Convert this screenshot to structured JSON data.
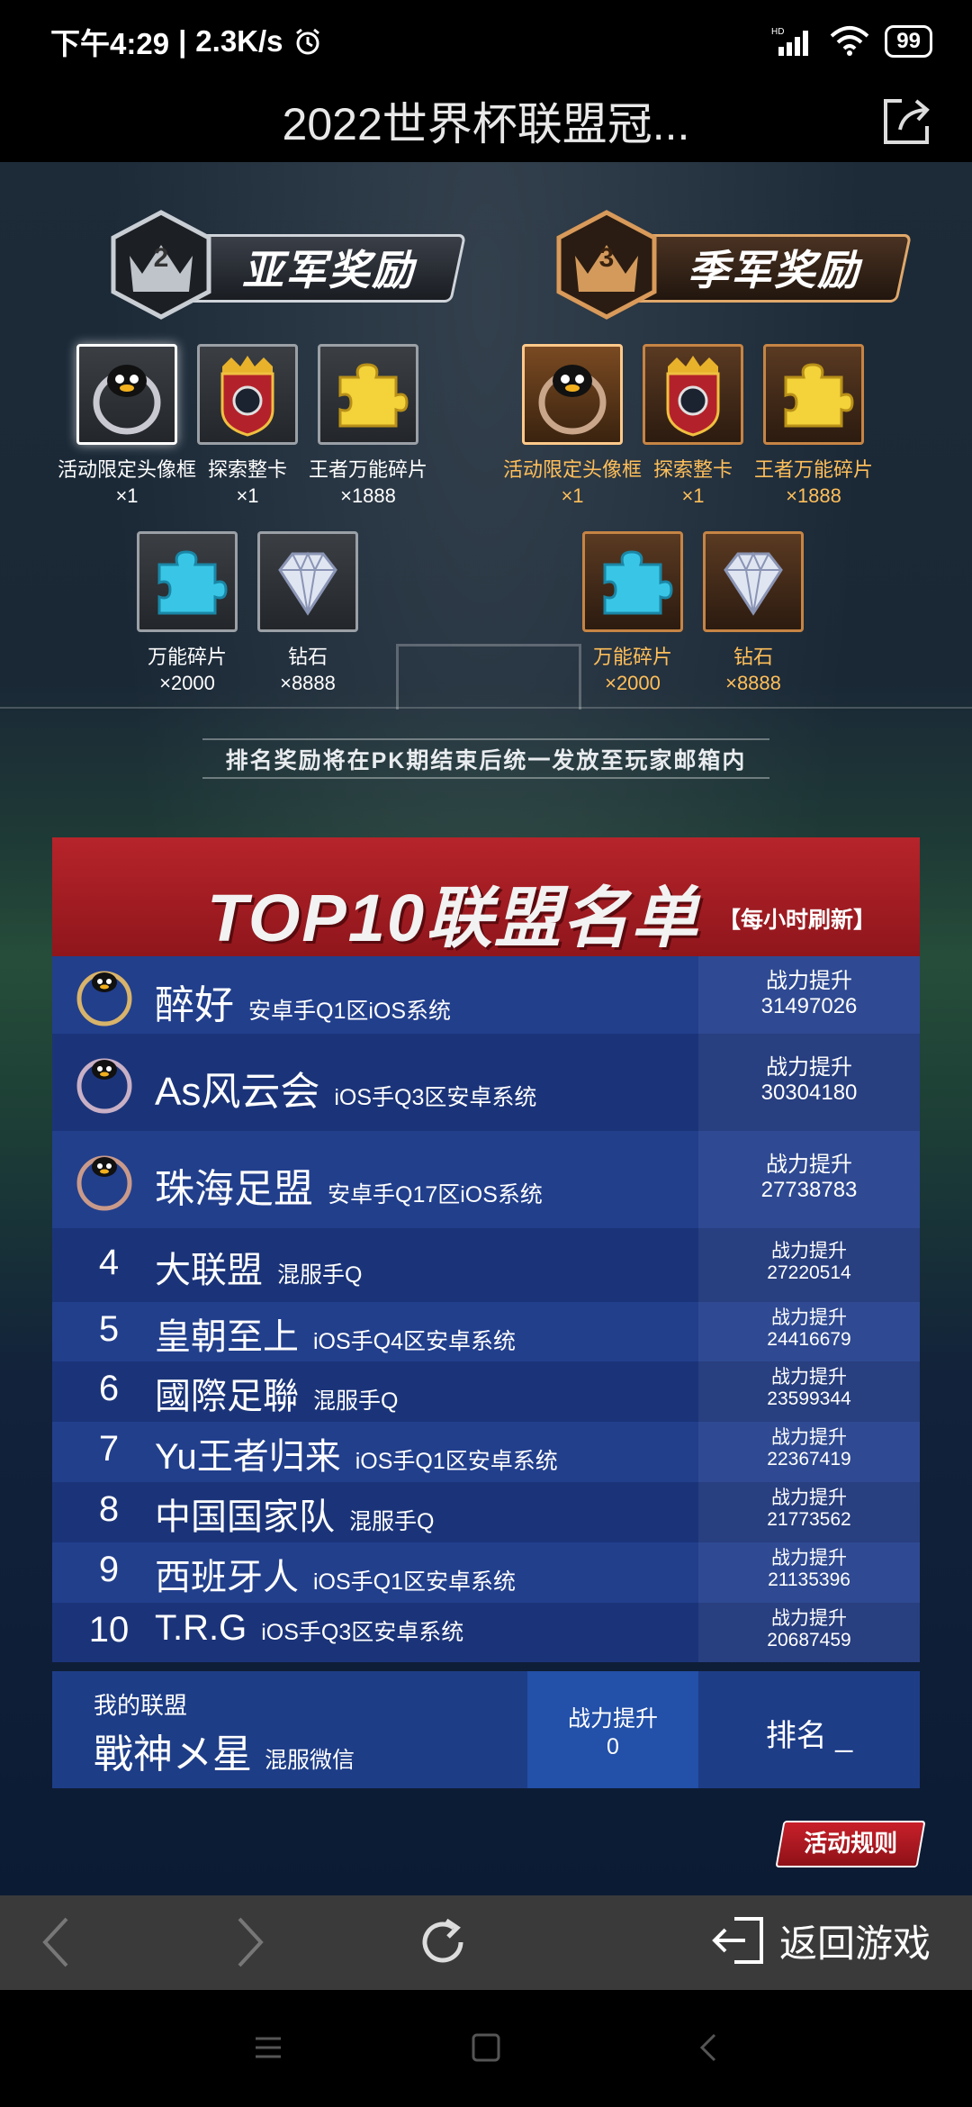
{
  "status_bar": {
    "time": "下午4:29",
    "speed": "2.3K/s",
    "battery": "99",
    "network": "HD"
  },
  "titlebar": {
    "title": "2022世界杯联盟冠..."
  },
  "rewards": [
    {
      "rank": "2",
      "title": "亚军奖励",
      "items_row1": [
        {
          "name": "活动限定头像框",
          "count": "×1",
          "icon": "avatar-frame-icon"
        },
        {
          "name": "探索整卡",
          "count": "×1",
          "icon": "explore-card-icon"
        },
        {
          "name": "王者万能碎片",
          "count": "×1888",
          "icon": "gold-puzzle-icon"
        }
      ],
      "items_row2": [
        {
          "name": "万能碎片",
          "count": "×2000",
          "icon": "blue-puzzle-icon"
        },
        {
          "name": "钻石",
          "count": "×8888",
          "icon": "diamond-icon"
        }
      ]
    },
    {
      "rank": "3",
      "title": "季军奖励",
      "items_row1": [
        {
          "name": "活动限定头像框",
          "count": "×1",
          "icon": "avatar-frame-icon"
        },
        {
          "name": "探索整卡",
          "count": "×1",
          "icon": "explore-card-icon"
        },
        {
          "name": "王者万能碎片",
          "count": "×1888",
          "icon": "gold-puzzle-icon"
        }
      ],
      "items_row2": [
        {
          "name": "万能碎片",
          "count": "×2000",
          "icon": "blue-puzzle-icon"
        },
        {
          "name": "钻石",
          "count": "×8888",
          "icon": "diamond-icon"
        }
      ]
    }
  ],
  "notice": "排名奖励将在PK期结束后统一发放至玩家邮箱内",
  "top10": {
    "title": "TOP10联盟名单",
    "subtitle": "【每小时刷新】",
    "stat_label": "战力提升",
    "rows": [
      {
        "rank": "1",
        "name": "醉好",
        "server": "安卓手Q1区iOS系统",
        "power": "31497026"
      },
      {
        "rank": "2",
        "name": "As风云会",
        "server": "iOS手Q3区安卓系统",
        "power": "30304180"
      },
      {
        "rank": "3",
        "name": "珠海足盟",
        "server": "安卓手Q17区iOS系统",
        "power": "27738783"
      },
      {
        "rank": "4",
        "name": "大联盟",
        "server": "混服手Q",
        "power": "27220514"
      },
      {
        "rank": "5",
        "name": "皇朝至上",
        "server": "iOS手Q4区安卓系统",
        "power": "24416679"
      },
      {
        "rank": "6",
        "name": "國際足聯",
        "server": "混服手Q",
        "power": "23599344"
      },
      {
        "rank": "7",
        "name": "Yu王者归来",
        "server": "iOS手Q1区安卓系统",
        "power": "22367419"
      },
      {
        "rank": "8",
        "name": "中国国家队",
        "server": "混服手Q",
        "power": "21773562"
      },
      {
        "rank": "9",
        "name": "西班牙人",
        "server": "iOS手Q1区安卓系统",
        "power": "21135396"
      },
      {
        "rank": "10",
        "name": "T.R.G",
        "server": "iOS手Q3区安卓系统",
        "power": "20687459"
      }
    ]
  },
  "my_alliance": {
    "label": "我的联盟",
    "name": "戰神メ星",
    "server": "混服微信",
    "power_label": "战力提升",
    "power": "0",
    "rank_text": "排名 _"
  },
  "rules_button": "活动规则",
  "browser_nav": {
    "back_game": "返回游戏"
  },
  "colors": {
    "panel_red": "#b6242a",
    "panel_blue": "#17306e",
    "bronze_text": "#ffbf5a"
  }
}
